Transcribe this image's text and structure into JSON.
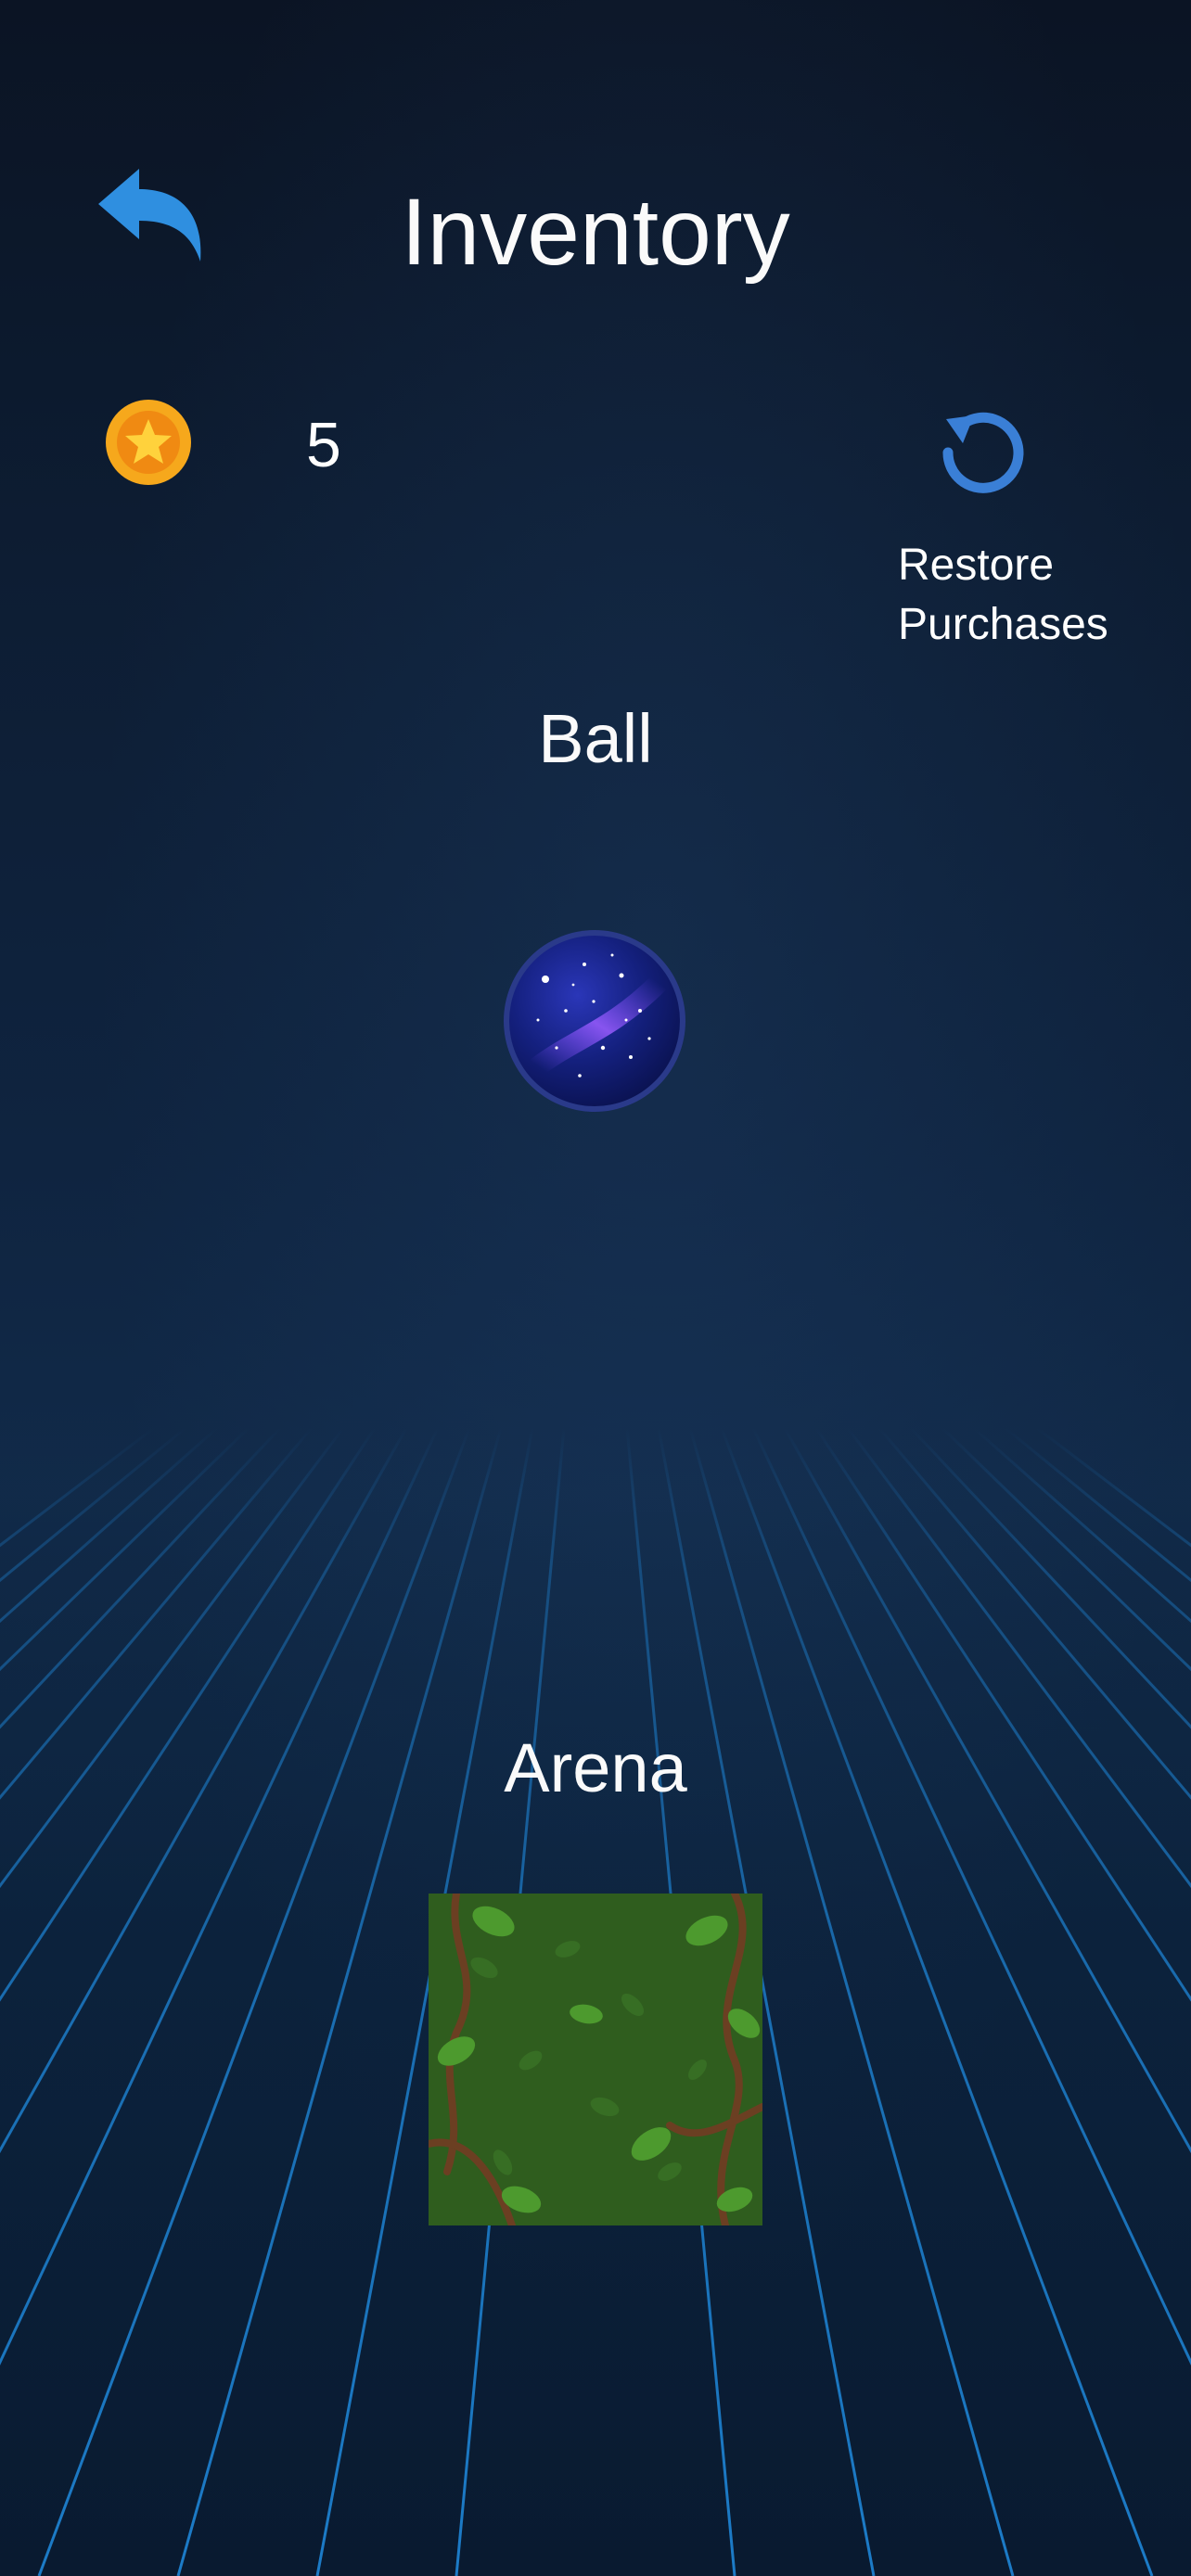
{
  "header": {
    "title": "Inventory",
    "back_icon": "back-arrow-icon"
  },
  "currency": {
    "icon": "star-coin-icon",
    "count": "5"
  },
  "restore": {
    "icon": "restore-icon",
    "label_line1": "Restore",
    "label_line2": "Purchases"
  },
  "ball": {
    "label": "Ball",
    "item": "galaxy-ball"
  },
  "arena": {
    "label": "Arena",
    "item": "jungle-leaves-arena"
  },
  "colors": {
    "accent": "#2f8fe0",
    "restore": "#3a7fd6",
    "coin": "#f6a81c",
    "grid": "#1e86d8",
    "text": "#ffffff"
  }
}
